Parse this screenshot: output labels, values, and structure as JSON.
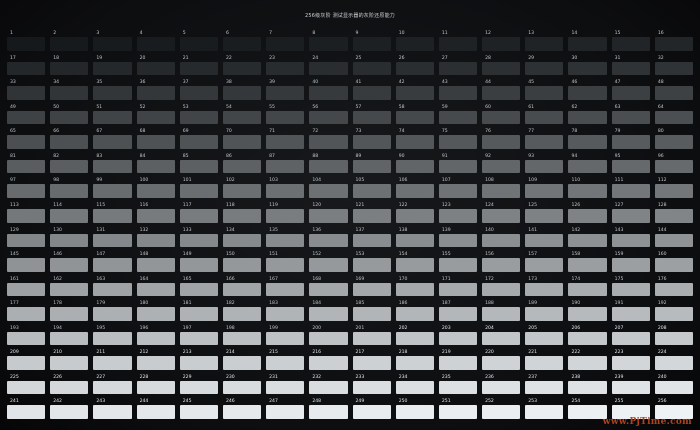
{
  "title": "256级灰阶 测试显示器的灰阶还原能力",
  "watermark": "www.PjTime.com",
  "patches": [
    {
      "n": "1",
      "l": 0
    },
    {
      "n": "2",
      "l": 1
    },
    {
      "n": "3",
      "l": 2
    },
    {
      "n": "4",
      "l": 3
    },
    {
      "n": "5",
      "l": 4
    },
    {
      "n": "6",
      "l": 5
    },
    {
      "n": "7",
      "l": 6
    },
    {
      "n": "8",
      "l": 7
    },
    {
      "n": "9",
      "l": 8
    },
    {
      "n": "10",
      "l": 9
    },
    {
      "n": "11",
      "l": 10
    },
    {
      "n": "12",
      "l": 11
    },
    {
      "n": "13",
      "l": 12
    },
    {
      "n": "14",
      "l": 13
    },
    {
      "n": "15",
      "l": 14
    },
    {
      "n": "16",
      "l": 15
    },
    {
      "n": "17",
      "l": 16
    },
    {
      "n": "18",
      "l": 17
    },
    {
      "n": "19",
      "l": 18
    },
    {
      "n": "20",
      "l": 19
    },
    {
      "n": "21",
      "l": 20
    },
    {
      "n": "22",
      "l": 21
    },
    {
      "n": "23",
      "l": 22
    },
    {
      "n": "24",
      "l": 23
    },
    {
      "n": "25",
      "l": 24
    },
    {
      "n": "26",
      "l": 25
    },
    {
      "n": "27",
      "l": 26
    },
    {
      "n": "28",
      "l": 27
    },
    {
      "n": "29",
      "l": 28
    },
    {
      "n": "30",
      "l": 29
    },
    {
      "n": "31",
      "l": 30
    },
    {
      "n": "32",
      "l": 31
    },
    {
      "n": "33",
      "l": 32
    },
    {
      "n": "34",
      "l": 33
    },
    {
      "n": "35",
      "l": 34
    },
    {
      "n": "36",
      "l": 35
    },
    {
      "n": "37",
      "l": 36
    },
    {
      "n": "38",
      "l": 37
    },
    {
      "n": "39",
      "l": 38
    },
    {
      "n": "40",
      "l": 39
    },
    {
      "n": "41",
      "l": 40
    },
    {
      "n": "42",
      "l": 41
    },
    {
      "n": "43",
      "l": 42
    },
    {
      "n": "44",
      "l": 43
    },
    {
      "n": "45",
      "l": 44
    },
    {
      "n": "46",
      "l": 45
    },
    {
      "n": "47",
      "l": 46
    },
    {
      "n": "48",
      "l": 47
    },
    {
      "n": "49",
      "l": 48
    },
    {
      "n": "50",
      "l": 49
    },
    {
      "n": "51",
      "l": 50
    },
    {
      "n": "52",
      "l": 51
    },
    {
      "n": "53",
      "l": 52
    },
    {
      "n": "54",
      "l": 53
    },
    {
      "n": "55",
      "l": 54
    },
    {
      "n": "56",
      "l": 55
    },
    {
      "n": "57",
      "l": 56
    },
    {
      "n": "58",
      "l": 57
    },
    {
      "n": "59",
      "l": 58
    },
    {
      "n": "60",
      "l": 59
    },
    {
      "n": "61",
      "l": 60
    },
    {
      "n": "62",
      "l": 61
    },
    {
      "n": "63",
      "l": 62
    },
    {
      "n": "64",
      "l": 63
    },
    {
      "n": "65",
      "l": 64
    },
    {
      "n": "66",
      "l": 65
    },
    {
      "n": "67",
      "l": 66
    },
    {
      "n": "68",
      "l": 67
    },
    {
      "n": "69",
      "l": 68
    },
    {
      "n": "70",
      "l": 69
    },
    {
      "n": "71",
      "l": 70
    },
    {
      "n": "72",
      "l": 71
    },
    {
      "n": "73",
      "l": 72
    },
    {
      "n": "74",
      "l": 73
    },
    {
      "n": "75",
      "l": 74
    },
    {
      "n": "76",
      "l": 75
    },
    {
      "n": "77",
      "l": 76
    },
    {
      "n": "78",
      "l": 77
    },
    {
      "n": "79",
      "l": 78
    },
    {
      "n": "80",
      "l": 79
    },
    {
      "n": "81",
      "l": 80
    },
    {
      "n": "82",
      "l": 81
    },
    {
      "n": "83",
      "l": 82
    },
    {
      "n": "84",
      "l": 83
    },
    {
      "n": "85",
      "l": 84
    },
    {
      "n": "86",
      "l": 85
    },
    {
      "n": "87",
      "l": 86
    },
    {
      "n": "88",
      "l": 87
    },
    {
      "n": "89",
      "l": 88
    },
    {
      "n": "90",
      "l": 89
    },
    {
      "n": "91",
      "l": 90
    },
    {
      "n": "92",
      "l": 91
    },
    {
      "n": "93",
      "l": 92
    },
    {
      "n": "94",
      "l": 93
    },
    {
      "n": "95",
      "l": 94
    },
    {
      "n": "96",
      "l": 95
    },
    {
      "n": "97",
      "l": 96
    },
    {
      "n": "98",
      "l": 97
    },
    {
      "n": "99",
      "l": 98
    },
    {
      "n": "100",
      "l": 99
    },
    {
      "n": "101",
      "l": 100
    },
    {
      "n": "102",
      "l": 101
    },
    {
      "n": "103",
      "l": 102
    },
    {
      "n": "104",
      "l": 103
    },
    {
      "n": "105",
      "l": 104
    },
    {
      "n": "106",
      "l": 105
    },
    {
      "n": "107",
      "l": 106
    },
    {
      "n": "108",
      "l": 107
    },
    {
      "n": "109",
      "l": 108
    },
    {
      "n": "110",
      "l": 109
    },
    {
      "n": "111",
      "l": 110
    },
    {
      "n": "112",
      "l": 111
    },
    {
      "n": "113",
      "l": 112
    },
    {
      "n": "114",
      "l": 113
    },
    {
      "n": "115",
      "l": 114
    },
    {
      "n": "116",
      "l": 115
    },
    {
      "n": "117",
      "l": 116
    },
    {
      "n": "118",
      "l": 117
    },
    {
      "n": "119",
      "l": 118
    },
    {
      "n": "120",
      "l": 119
    },
    {
      "n": "121",
      "l": 120
    },
    {
      "n": "122",
      "l": 121
    },
    {
      "n": "123",
      "l": 122
    },
    {
      "n": "124",
      "l": 123
    },
    {
      "n": "125",
      "l": 124
    },
    {
      "n": "126",
      "l": 125
    },
    {
      "n": "127",
      "l": 126
    },
    {
      "n": "128",
      "l": 127
    },
    {
      "n": "129",
      "l": 128
    },
    {
      "n": "130",
      "l": 129
    },
    {
      "n": "131",
      "l": 130
    },
    {
      "n": "132",
      "l": 131
    },
    {
      "n": "133",
      "l": 132
    },
    {
      "n": "134",
      "l": 133
    },
    {
      "n": "135",
      "l": 134
    },
    {
      "n": "136",
      "l": 135
    },
    {
      "n": "137",
      "l": 136
    },
    {
      "n": "138",
      "l": 137
    },
    {
      "n": "139",
      "l": 138
    },
    {
      "n": "140",
      "l": 139
    },
    {
      "n": "141",
      "l": 140
    },
    {
      "n": "142",
      "l": 141
    },
    {
      "n": "143",
      "l": 142
    },
    {
      "n": "144",
      "l": 143
    },
    {
      "n": "145",
      "l": 144
    },
    {
      "n": "146",
      "l": 145
    },
    {
      "n": "147",
      "l": 146
    },
    {
      "n": "148",
      "l": 147
    },
    {
      "n": "149",
      "l": 148
    },
    {
      "n": "150",
      "l": 149
    },
    {
      "n": "151",
      "l": 150
    },
    {
      "n": "152",
      "l": 151
    },
    {
      "n": "153",
      "l": 152
    },
    {
      "n": "154",
      "l": 153
    },
    {
      "n": "155",
      "l": 154
    },
    {
      "n": "156",
      "l": 155
    },
    {
      "n": "157",
      "l": 156
    },
    {
      "n": "158",
      "l": 157
    },
    {
      "n": "159",
      "l": 158
    },
    {
      "n": "160",
      "l": 159
    },
    {
      "n": "161",
      "l": 160
    },
    {
      "n": "162",
      "l": 161
    },
    {
      "n": "163",
      "l": 162
    },
    {
      "n": "164",
      "l": 163
    },
    {
      "n": "165",
      "l": 164
    },
    {
      "n": "166",
      "l": 165
    },
    {
      "n": "167",
      "l": 166
    },
    {
      "n": "168",
      "l": 167
    },
    {
      "n": "169",
      "l": 168
    },
    {
      "n": "170",
      "l": 169
    },
    {
      "n": "171",
      "l": 170
    },
    {
      "n": "172",
      "l": 171
    },
    {
      "n": "173",
      "l": 172
    },
    {
      "n": "174",
      "l": 173
    },
    {
      "n": "175",
      "l": 174
    },
    {
      "n": "176",
      "l": 175
    },
    {
      "n": "177",
      "l": 176
    },
    {
      "n": "178",
      "l": 177
    },
    {
      "n": "179",
      "l": 178
    },
    {
      "n": "180",
      "l": 179
    },
    {
      "n": "181",
      "l": 180
    },
    {
      "n": "182",
      "l": 181
    },
    {
      "n": "183",
      "l": 182
    },
    {
      "n": "184",
      "l": 183
    },
    {
      "n": "185",
      "l": 184
    },
    {
      "n": "186",
      "l": 185
    },
    {
      "n": "187",
      "l": 186
    },
    {
      "n": "188",
      "l": 187
    },
    {
      "n": "189",
      "l": 188
    },
    {
      "n": "190",
      "l": 189
    },
    {
      "n": "191",
      "l": 190
    },
    {
      "n": "192",
      "l": 191
    },
    {
      "n": "193",
      "l": 192
    },
    {
      "n": "194",
      "l": 193
    },
    {
      "n": "195",
      "l": 194
    },
    {
      "n": "196",
      "l": 195
    },
    {
      "n": "197",
      "l": 196
    },
    {
      "n": "198",
      "l": 197
    },
    {
      "n": "199",
      "l": 198
    },
    {
      "n": "200",
      "l": 199
    },
    {
      "n": "201",
      "l": 200
    },
    {
      "n": "202",
      "l": 201
    },
    {
      "n": "203",
      "l": 202
    },
    {
      "n": "204",
      "l": 203
    },
    {
      "n": "205",
      "l": 204
    },
    {
      "n": "206",
      "l": 205
    },
    {
      "n": "207",
      "l": 206
    },
    {
      "n": "208",
      "l": 207
    },
    {
      "n": "209",
      "l": 208
    },
    {
      "n": "210",
      "l": 209
    },
    {
      "n": "211",
      "l": 210
    },
    {
      "n": "212",
      "l": 211
    },
    {
      "n": "213",
      "l": 212
    },
    {
      "n": "214",
      "l": 213
    },
    {
      "n": "215",
      "l": 214
    },
    {
      "n": "216",
      "l": 215
    },
    {
      "n": "217",
      "l": 216
    },
    {
      "n": "218",
      "l": 217
    },
    {
      "n": "219",
      "l": 218
    },
    {
      "n": "220",
      "l": 219
    },
    {
      "n": "221",
      "l": 220
    },
    {
      "n": "222",
      "l": 221
    },
    {
      "n": "223",
      "l": 222
    },
    {
      "n": "224",
      "l": 223
    },
    {
      "n": "225",
      "l": 224
    },
    {
      "n": "226",
      "l": 225
    },
    {
      "n": "227",
      "l": 226
    },
    {
      "n": "228",
      "l": 227
    },
    {
      "n": "229",
      "l": 228
    },
    {
      "n": "230",
      "l": 229
    },
    {
      "n": "231",
      "l": 230
    },
    {
      "n": "232",
      "l": 231
    },
    {
      "n": "233",
      "l": 232
    },
    {
      "n": "234",
      "l": 233
    },
    {
      "n": "235",
      "l": 234
    },
    {
      "n": "236",
      "l": 235
    },
    {
      "n": "237",
      "l": 236
    },
    {
      "n": "238",
      "l": 237
    },
    {
      "n": "239",
      "l": 238
    },
    {
      "n": "240",
      "l": 239
    },
    {
      "n": "241",
      "l": 240
    },
    {
      "n": "242",
      "l": 241
    },
    {
      "n": "243",
      "l": 242
    },
    {
      "n": "244",
      "l": 243
    },
    {
      "n": "245",
      "l": 244
    },
    {
      "n": "246",
      "l": 245
    },
    {
      "n": "247",
      "l": 246
    },
    {
      "n": "248",
      "l": 247
    },
    {
      "n": "249",
      "l": 248
    },
    {
      "n": "250",
      "l": 249
    },
    {
      "n": "251",
      "l": 250
    },
    {
      "n": "252",
      "l": 251
    },
    {
      "n": "253",
      "l": 252
    },
    {
      "n": "254",
      "l": 253
    },
    {
      "n": "255",
      "l": 254
    },
    {
      "n": "256",
      "l": 255
    }
  ]
}
